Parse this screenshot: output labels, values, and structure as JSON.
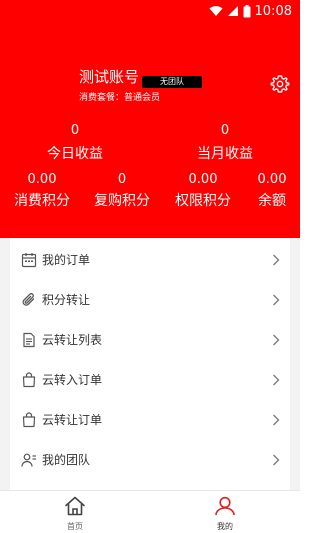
{
  "status_bar": {
    "time": "10:08"
  },
  "header": {
    "account_name": "测试账号",
    "team_badge": "无团队",
    "package_line": "消费套餐：普通会员"
  },
  "stats": {
    "today_earnings": {
      "value": "0",
      "label": "今日收益"
    },
    "month_earnings": {
      "value": "0",
      "label": "当月收益"
    },
    "consume_points": {
      "value": "0.00",
      "label": "消费积分"
    },
    "repurchase_points": {
      "value": "0",
      "label": "复购积分"
    },
    "limit_points": {
      "value": "0.00",
      "label": "权限积分"
    },
    "balance": {
      "value": "0.00",
      "label": "余额"
    }
  },
  "menu": {
    "items": [
      {
        "label": "我的订单",
        "icon": "calendar-icon"
      },
      {
        "label": "积分转让",
        "icon": "paperclip-icon"
      },
      {
        "label": "云转让列表",
        "icon": "document-icon"
      },
      {
        "label": "云转入订单",
        "icon": "shopping-bag-icon"
      },
      {
        "label": "云转让订单",
        "icon": "shopping-bag-icon"
      },
      {
        "label": "我的团队",
        "icon": "team-icon"
      }
    ]
  },
  "bottom_nav": {
    "home": {
      "label": "首页",
      "icon": "home-icon"
    },
    "mine": {
      "label": "我的",
      "icon": "user-icon"
    }
  },
  "colors": {
    "brand_red": "#ff0000",
    "nav_active": "#e02020",
    "nav_inactive": "#666666"
  }
}
